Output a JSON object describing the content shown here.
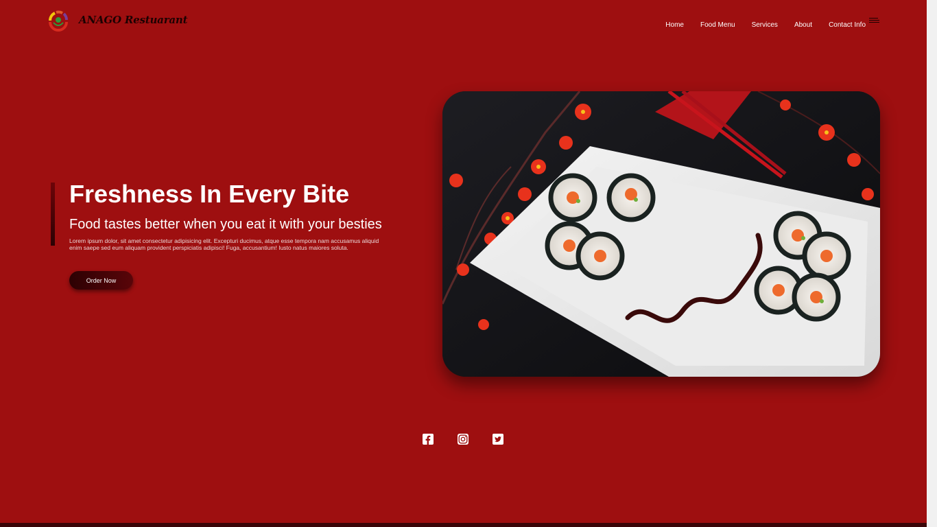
{
  "brand": {
    "name": "ANAGO Restuarant",
    "logo_icon": "restaurant-logo-icon"
  },
  "nav": {
    "items": [
      "Home",
      "Food Menu",
      "Services",
      "About",
      "Contact Info"
    ],
    "menu_icon": "hamburger-menu-icon"
  },
  "hero": {
    "title": "Freshness In Every Bite",
    "subtitle": "Food tastes better when you eat it with your besties",
    "text": "Lorem ipsum dolor, sit amet consectetur adipisicing elit. Excepturi ducimus, atque esse tempora nam accusamus aliquid enim saepe sed eum aliquam provident perspiciatis adipisci! Fuga, accusantium! Iusto natus maiores soluta.",
    "cta_label": "Order Now",
    "image_subject": "sushi-plate-image"
  },
  "social": {
    "icons": [
      "facebook-icon",
      "instagram-icon",
      "twitter-icon"
    ]
  },
  "colors": {
    "background": "#9e0f10",
    "button": "#3a0206",
    "text": "#ffffff"
  }
}
